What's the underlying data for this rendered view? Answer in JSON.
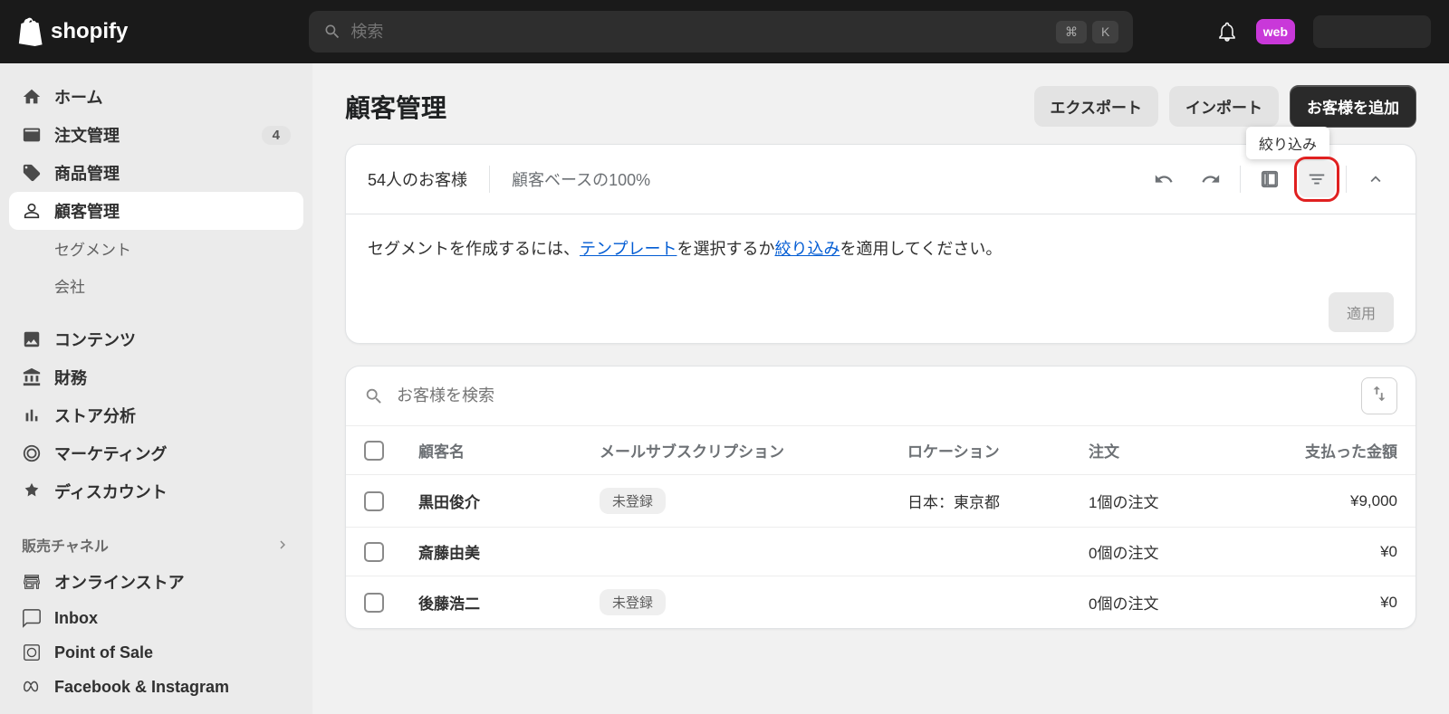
{
  "brand": "shopify",
  "search": {
    "placeholder": "検索",
    "shortcut_cmd": "⌘",
    "shortcut_k": "K"
  },
  "avatar_text": "web",
  "nav": {
    "home": "ホーム",
    "orders": "注文管理",
    "orders_badge": "4",
    "products": "商品管理",
    "customers": "顧客管理",
    "segments": "セグメント",
    "companies": "会社",
    "content": "コンテンツ",
    "finance": "財務",
    "analytics": "ストア分析",
    "marketing": "マーケティング",
    "discounts": "ディスカウント",
    "channels_header": "販売チャネル",
    "online_store": "オンラインストア",
    "inbox": "Inbox",
    "pos": "Point of Sale",
    "fb_ig": "Facebook & Instagram"
  },
  "page": {
    "title": "顧客管理",
    "export": "エクスポート",
    "import": "インポート",
    "add_customer": "お客様を追加",
    "tooltip_filter": "絞り込み"
  },
  "segment_card": {
    "stat_count": "54人のお客様",
    "stat_percent": "顧客ベースの100%",
    "help_prefix": "セグメントを作成するには、",
    "help_template_link": "テンプレート",
    "help_mid": "を選択するか",
    "help_filter_link": "絞り込み",
    "help_suffix": "を適用してください。",
    "apply": "適用"
  },
  "table": {
    "search_placeholder": "お客様を検索",
    "col_name": "顧客名",
    "col_subscription": "メールサブスクリプション",
    "col_location": "ロケーション",
    "col_orders": "注文",
    "col_amount": "支払った金額",
    "badge_unregistered": "未登録",
    "rows": [
      {
        "name": "黒田俊介",
        "sub": "未登録",
        "location": "日本：東京都",
        "orders": "1個の注文",
        "amount": "¥9,000"
      },
      {
        "name": "斎藤由美",
        "sub": "",
        "location": "",
        "orders": "0個の注文",
        "amount": "¥0"
      },
      {
        "name": "後藤浩二",
        "sub": "未登録",
        "location": "",
        "orders": "0個の注文",
        "amount": "¥0"
      }
    ]
  }
}
